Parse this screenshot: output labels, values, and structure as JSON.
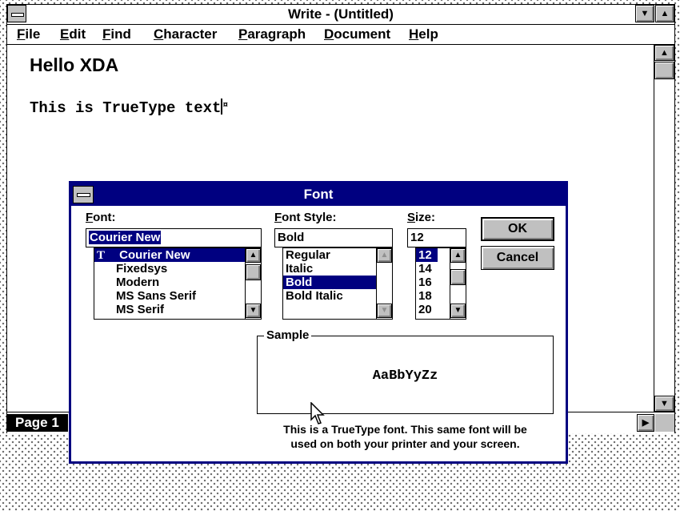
{
  "write_window": {
    "title": "Write - (Untitled)",
    "minimize_glyph": "▼",
    "maximize_glyph": "▲",
    "menu": [
      "File",
      "Edit",
      "Find",
      "Character",
      "Paragraph",
      "Document",
      "Help"
    ],
    "document": {
      "heading": "Hello XDA",
      "body": "This is TrueType text",
      "paragraph_mark": "¤"
    },
    "status": {
      "page_label": "Page 1"
    },
    "scroll_glyphs": {
      "up": "▲",
      "down": "▼",
      "right": "▶"
    }
  },
  "font_dialog": {
    "title": "Font",
    "font": {
      "label": "Font:",
      "value": "Courier New",
      "items": [
        "Courier New",
        "Fixedsys",
        "Modern",
        "MS Sans Serif",
        "MS Serif"
      ],
      "selected_index": 0,
      "truetype_icon": "T"
    },
    "style": {
      "label": "Font Style:",
      "value": "Bold",
      "items": [
        "Regular",
        "Italic",
        "Bold",
        "Bold Italic"
      ],
      "selected_index": 2
    },
    "size": {
      "label": "Size:",
      "value": "12",
      "items": [
        "12",
        "14",
        "16",
        "18",
        "20"
      ],
      "selected_index": 0
    },
    "buttons": {
      "ok": "OK",
      "cancel": "Cancel"
    },
    "sample": {
      "legend": "Sample",
      "text": "AaBbYyZz"
    },
    "info_line1": "This is a TrueType font. This same font will be",
    "info_line2": "used on both your printer and your screen."
  },
  "colors": {
    "selection": "#000080",
    "button_face": "#c0c0c0",
    "desktop_dots": "#6a6a6a"
  }
}
